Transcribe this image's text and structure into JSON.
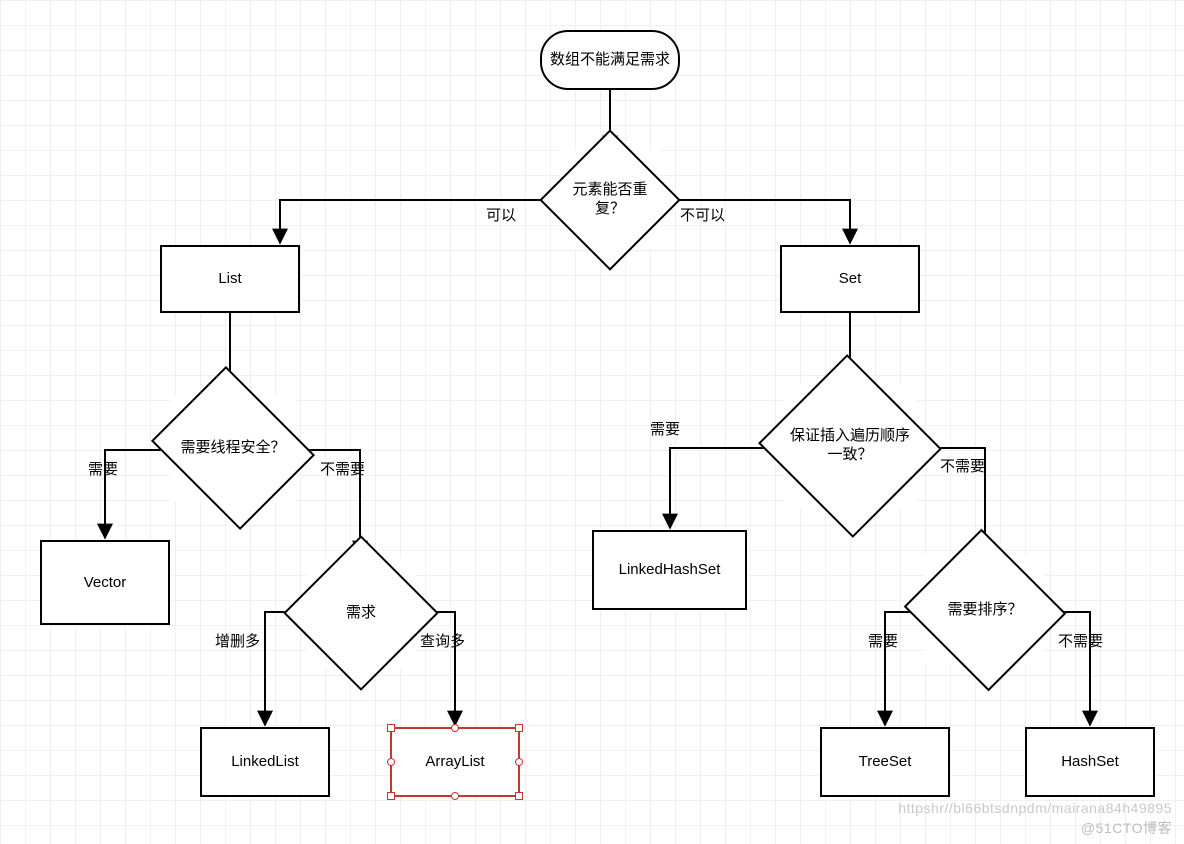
{
  "start": "数组不能满足需求",
  "decisions": {
    "repeatable": "元素能否重复？",
    "threadSafe": "需要线程安全？",
    "need": "需求",
    "orderConsistent": "保证插入遍历顺序一致？",
    "needSort": "需要排序？"
  },
  "boxes": {
    "list": "List",
    "set": "Set",
    "vector": "Vector",
    "linkedList": "LinkedList",
    "arrayList": "ArrayList",
    "linkedHashSet": "LinkedHashSet",
    "treeSet": "TreeSet",
    "hashSet": "HashSet"
  },
  "labels": {
    "yes": "可以",
    "no": "不可以",
    "need": "需要",
    "notNeed": "不需要",
    "moreAddDel": "增删多",
    "moreQuery": "查询多"
  },
  "watermark_top": "httpshr//bl66btsdnpdm/mairana84h49895",
  "watermark_bottom": "@51CTO博客",
  "structure": {
    "note": "Decision tree for choosing a Java Collection implementation based on duplication, thread safety, insertion-order, sorting and access pattern requirements.",
    "edges": [
      {
        "from": "start",
        "to": "repeatable"
      },
      {
        "from": "repeatable",
        "label": "yes",
        "to": "list"
      },
      {
        "from": "repeatable",
        "label": "no",
        "to": "set"
      },
      {
        "from": "list",
        "to": "threadSafe"
      },
      {
        "from": "threadSafe",
        "label": "need",
        "to": "vector"
      },
      {
        "from": "threadSafe",
        "label": "notNeed",
        "to": "need"
      },
      {
        "from": "need",
        "label": "moreAddDel",
        "to": "linkedList"
      },
      {
        "from": "need",
        "label": "moreQuery",
        "to": "arrayList"
      },
      {
        "from": "set",
        "to": "orderConsistent"
      },
      {
        "from": "orderConsistent",
        "label": "need",
        "to": "linkedHashSet"
      },
      {
        "from": "orderConsistent",
        "label": "notNeed",
        "to": "needSort"
      },
      {
        "from": "needSort",
        "label": "need",
        "to": "treeSet"
      },
      {
        "from": "needSort",
        "label": "notNeed",
        "to": "hashSet"
      }
    ]
  }
}
